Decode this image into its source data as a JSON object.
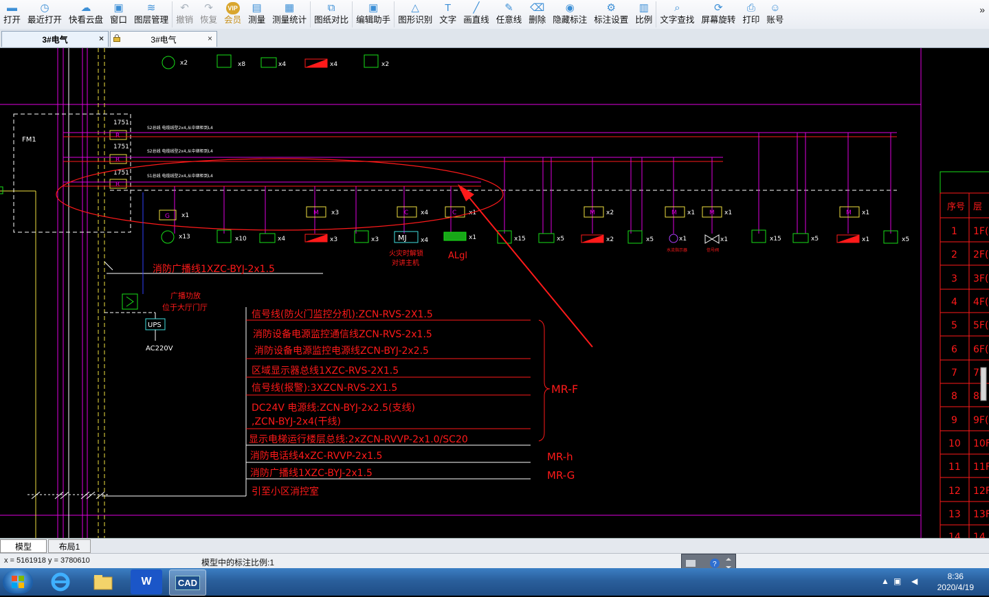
{
  "toolbar": {
    "items": [
      {
        "label": "打开",
        "icon": "folder-icon"
      },
      {
        "label": "最近打开",
        "icon": "clock-icon"
      },
      {
        "label": "快看云盘",
        "icon": "cloud-icon"
      },
      {
        "label": "窗口",
        "icon": "window-icon"
      },
      {
        "label": "图层管理",
        "icon": "layers-icon"
      },
      {
        "label": "撤销",
        "icon": "undo-icon"
      },
      {
        "label": "恢复",
        "icon": "redo-icon"
      },
      {
        "label": "会员",
        "icon": "vip-icon"
      },
      {
        "label": "测量",
        "icon": "ruler-icon"
      },
      {
        "label": "测量统计",
        "icon": "measure-stats-icon"
      },
      {
        "label": "图纸对比",
        "icon": "compare-icon"
      },
      {
        "label": "编辑助手",
        "icon": "cad-edit-icon"
      },
      {
        "label": "图形识别",
        "icon": "shape-recognize-icon"
      },
      {
        "label": "文字",
        "icon": "text-icon"
      },
      {
        "label": "画直线",
        "icon": "line-icon"
      },
      {
        "label": "任意线",
        "icon": "pencil-icon"
      },
      {
        "label": "删除",
        "icon": "eraser-icon"
      },
      {
        "label": "隐藏标注",
        "icon": "eye-icon"
      },
      {
        "label": "标注设置",
        "icon": "settings-icon"
      },
      {
        "label": "比例",
        "icon": "scale-icon"
      },
      {
        "label": "文字查找",
        "icon": "text-search-icon"
      },
      {
        "label": "屏幕旋转",
        "icon": "rotate-icon"
      },
      {
        "label": "打印",
        "icon": "printer-icon"
      },
      {
        "label": "账号",
        "icon": "user-icon"
      }
    ],
    "more": "»"
  },
  "tabs": [
    {
      "label": "3#电气",
      "close": "×"
    },
    {
      "label": "3#电气",
      "close": "×"
    }
  ],
  "drawing": {
    "fm1": "FM1",
    "module_label": "1751",
    "r_label": "R",
    "bus1": "S2总线 电缆线型2x4,从中继柜到L4",
    "bus2": "S2总线 电缆线型2x4,从中继柜到L4",
    "bus3": "S1总线 电缆线型2x4,从中继柜到L4",
    "row_top": {
      "q1": "x2",
      "q2": "x8",
      "q3": "x4",
      "q4": "x4",
      "q5": "x2"
    },
    "sym": {
      "g": "G",
      "m": "M",
      "c": "C",
      "mj": "MJ",
      "ups": "UPS"
    },
    "counts": {
      "g": "x1",
      "m1": "x3",
      "c1": "x4",
      "c2": "x1",
      "spk": "x13",
      "sw": "x10",
      "sm": "x4",
      "bar": "x3",
      "vl": "x3",
      "mj": "x4",
      "al": "x1",
      "s1": "x15",
      "s2": "x5",
      "s3": "x2",
      "s4": "x5",
      "s5": "x1",
      "s6": "x1",
      "s7": "x15",
      "s8": "x5",
      "s9": "x1",
      "s10": "x5",
      "m2": "x2",
      "m3": "x1",
      "m4": "x1",
      "m5": "x1"
    },
    "mj_label1": "火灾时解锁",
    "mj_label2": "对讲主机",
    "al_label": "ALgl",
    "small1": "水流指示器",
    "small2": "信号阀",
    "broadcast_line": "消防广播线1XZC-BYJ-2x1.5",
    "broadcast_amp1": "广播功放",
    "broadcast_amp2": "位于大厅门厅",
    "ac": "AC220V",
    "cable_list": [
      "信号线(防火门监控分机):ZCN-RVS-2X1.5",
      "消防设备电源监控通信线ZCN-RVS-2x1.5",
      "消防设备电源监控电源线ZCN-BYJ-2x2.5",
      "区域显示器总线1XZC-RVS-2X1.5",
      "信号线(报警):3XZCN-RVS-2X1.5",
      "DC24V 电源线:ZCN-BYJ-2x2.5(支线)",
      ",ZCN-BYJ-2x4(干线)",
      "显示电梯运行楼层总线:2xZCN-RVVP-2x1.0/SC20",
      "消防电话线4xZC-RVVP-2x1.5",
      "消防广播线1XZC-BYJ-2x1.5",
      "引至小区消控室"
    ],
    "mrf": "MR-F",
    "mrh": "MR-h",
    "mrg": "MR-G",
    "table_header": [
      "序号",
      "层"
    ],
    "table_rows": [
      {
        "n": "1",
        "f": "1F("
      },
      {
        "n": "2",
        "f": "2F("
      },
      {
        "n": "3",
        "f": "3F("
      },
      {
        "n": "4",
        "f": "4F("
      },
      {
        "n": "5",
        "f": "5F("
      },
      {
        "n": "6",
        "f": "6F("
      },
      {
        "n": "7",
        "f": "7F"
      },
      {
        "n": "8",
        "f": "8F"
      },
      {
        "n": "9",
        "f": "9F("
      },
      {
        "n": "10",
        "f": "10F"
      },
      {
        "n": "11",
        "f": "11F"
      },
      {
        "n": "12",
        "f": "12F"
      },
      {
        "n": "13",
        "f": "13F"
      },
      {
        "n": "14",
        "f": "14"
      }
    ]
  },
  "layout_tabs": {
    "model": "模型",
    "layout1": "布局1"
  },
  "status": {
    "coords": "x = 5161918  y = 3780610",
    "scale": "模型中的标注比例:1"
  },
  "taskbar": {
    "time": "8:36",
    "date": "2020/4/19",
    "cad": "CAD",
    "wps": "W"
  },
  "colors": {
    "magenta": "#e000e0",
    "red": "#ff1a1a",
    "green": "#18e018",
    "yellow": "#f0e040",
    "cyan": "#40e0e0",
    "white": "#ffffff"
  }
}
